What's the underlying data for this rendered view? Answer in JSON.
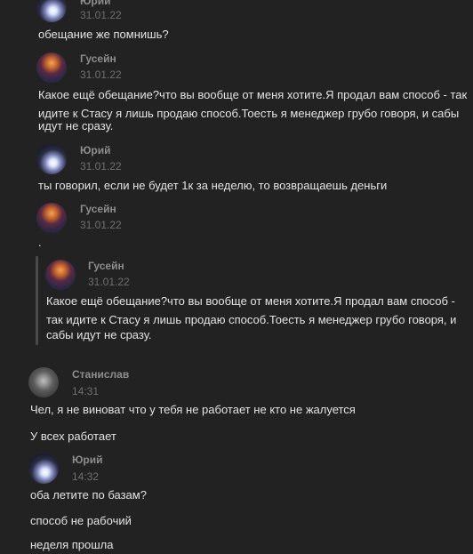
{
  "messages": [
    {
      "author": "Юрий",
      "date": "31.01.22",
      "text": "обещание же помнишь?"
    },
    {
      "author": "Гусейн",
      "date": "31.01.22",
      "text_lines": [
        "Какое ещё обещание?что вы вообще от меня хотите.Я продал вам способ - так",
        "идите к Стасу я лишь продаю способ.Тоесть я менеджер грубо говоря, и сабы",
        "идут не сразу."
      ]
    },
    {
      "author": "Юрий",
      "date": "31.01.22",
      "text": "ты говорил, если не будет 1к за неделю, то возвращаешь деньги"
    },
    {
      "author": "Гусейн",
      "date": "31.01.22",
      "text": "."
    },
    {
      "quoted": {
        "author": "Гусейн",
        "date": "31.01.22",
        "text_lines": [
          "Какое ещё обещание?что вы вообще от меня хотите.Я продал вам способ -",
          "так идите к Стасу я лишь продаю способ.Тоесть я менеджер грубо говоря, и",
          "сабы идут не сразу."
        ]
      }
    },
    {
      "author": "Станислав",
      "date": "14:31",
      "text": "Чел, я не виноват что у тебя не работает не кто не жалуется",
      "text2": "У всех работает"
    },
    {
      "author": "Юрий",
      "date": "14:32",
      "text": "оба летите по базам?",
      "text2": "способ не рабочий",
      "text3": "неделя прошла"
    }
  ]
}
